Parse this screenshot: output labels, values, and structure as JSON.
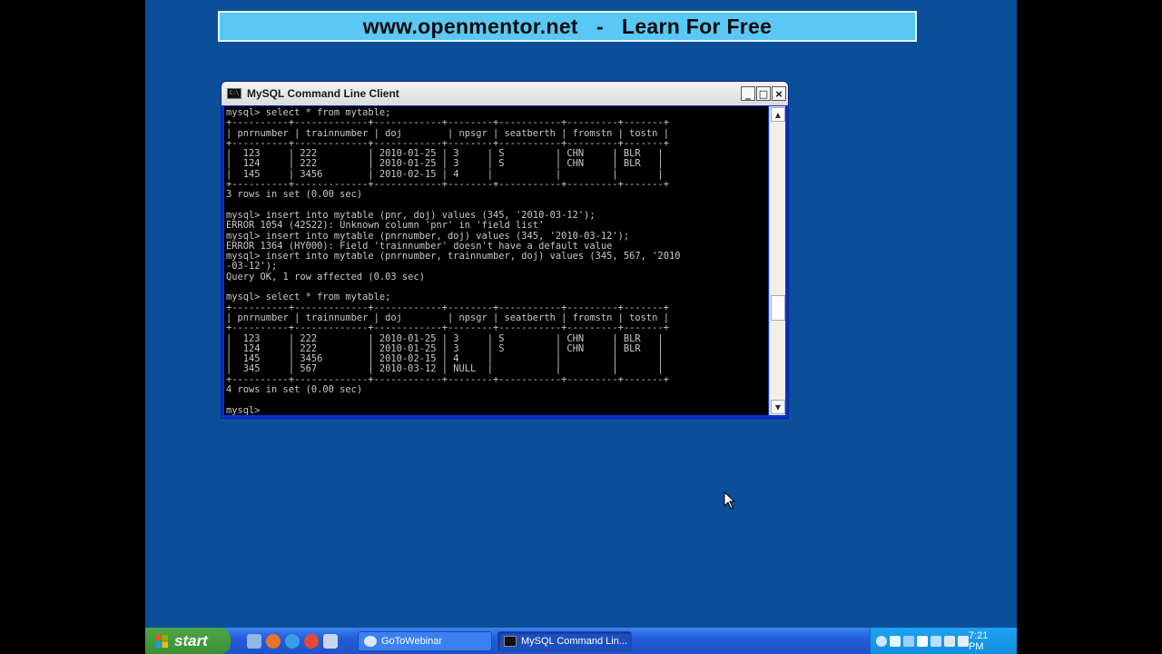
{
  "banner": {
    "text": "www.openmentor.net   -   Learn For Free"
  },
  "window": {
    "title": "MySQL Command Line Client",
    "buttons": {
      "minimize": "_",
      "maximize": "□",
      "close": "×"
    }
  },
  "console": {
    "text": "mysql> select * from mytable;\n+----------+-------------+------------+--------+-----------+---------+-------+\n| pnrnumber | trainnumber | doj        | npsgr | seatberth | fromstn | tostn |\n+----------+-------------+------------+--------+-----------+---------+-------+\n|  123     | 222         | 2010-01-25 | 3     | S         | CHN     | BLR   |\n|  124     | 222         | 2010-01-25 | 3     | S         | CHN     | BLR   |\n|  145     | 3456        | 2010-02-15 | 4     |           |         |       |\n+----------+-------------+------------+--------+-----------+---------+-------+\n3 rows in set (0.00 sec)\n\nmysql> insert into mytable (pnr, doj) values (345, '2010-03-12');\nERROR 1054 (42S22): Unknown column 'pnr' in 'field list'\nmysql> insert into mytable (pnrnumber, doj) values (345, '2010-03-12');\nERROR 1364 (HY000): Field 'trainnumber' doesn't have a default value\nmysql> insert into mytable (pnrnumber, trainnumber, doj) values (345, 567, '2010\n-03-12');\nQuery OK, 1 row affected (0.03 sec)\n\nmysql> select * from mytable;\n+----------+-------------+------------+--------+-----------+---------+-------+\n| pnrnumber | trainnumber | doj        | npsgr | seatberth | fromstn | tostn |\n+----------+-------------+------------+--------+-----------+---------+-------+\n|  123     | 222         | 2010-01-25 | 3     | S         | CHN     | BLR   |\n|  124     | 222         | 2010-01-25 | 3     | S         | CHN     | BLR   |\n|  145     | 3456        | 2010-02-15 | 4     |           |         |       |\n|  345     | 567         | 2010-03-12 | NULL  |           |         |       |\n+----------+-------------+------------+--------+-----------+---------+-------+\n4 rows in set (0.00 sec)\n\nmysql>"
  },
  "taskbar": {
    "start_label": "start",
    "tasks": [
      {
        "label": "GoToWebinar",
        "active": false
      },
      {
        "label": "MySQL Command Lin...",
        "active": true
      }
    ],
    "clock": "7:21 PM"
  },
  "colors": {
    "desktop": "#0b4f9a",
    "banner": "#5ac8f5",
    "console_bg": "#000000",
    "console_fg": "#c8c8c8",
    "taskbar": "#245edb",
    "start": "#3b8f34"
  }
}
